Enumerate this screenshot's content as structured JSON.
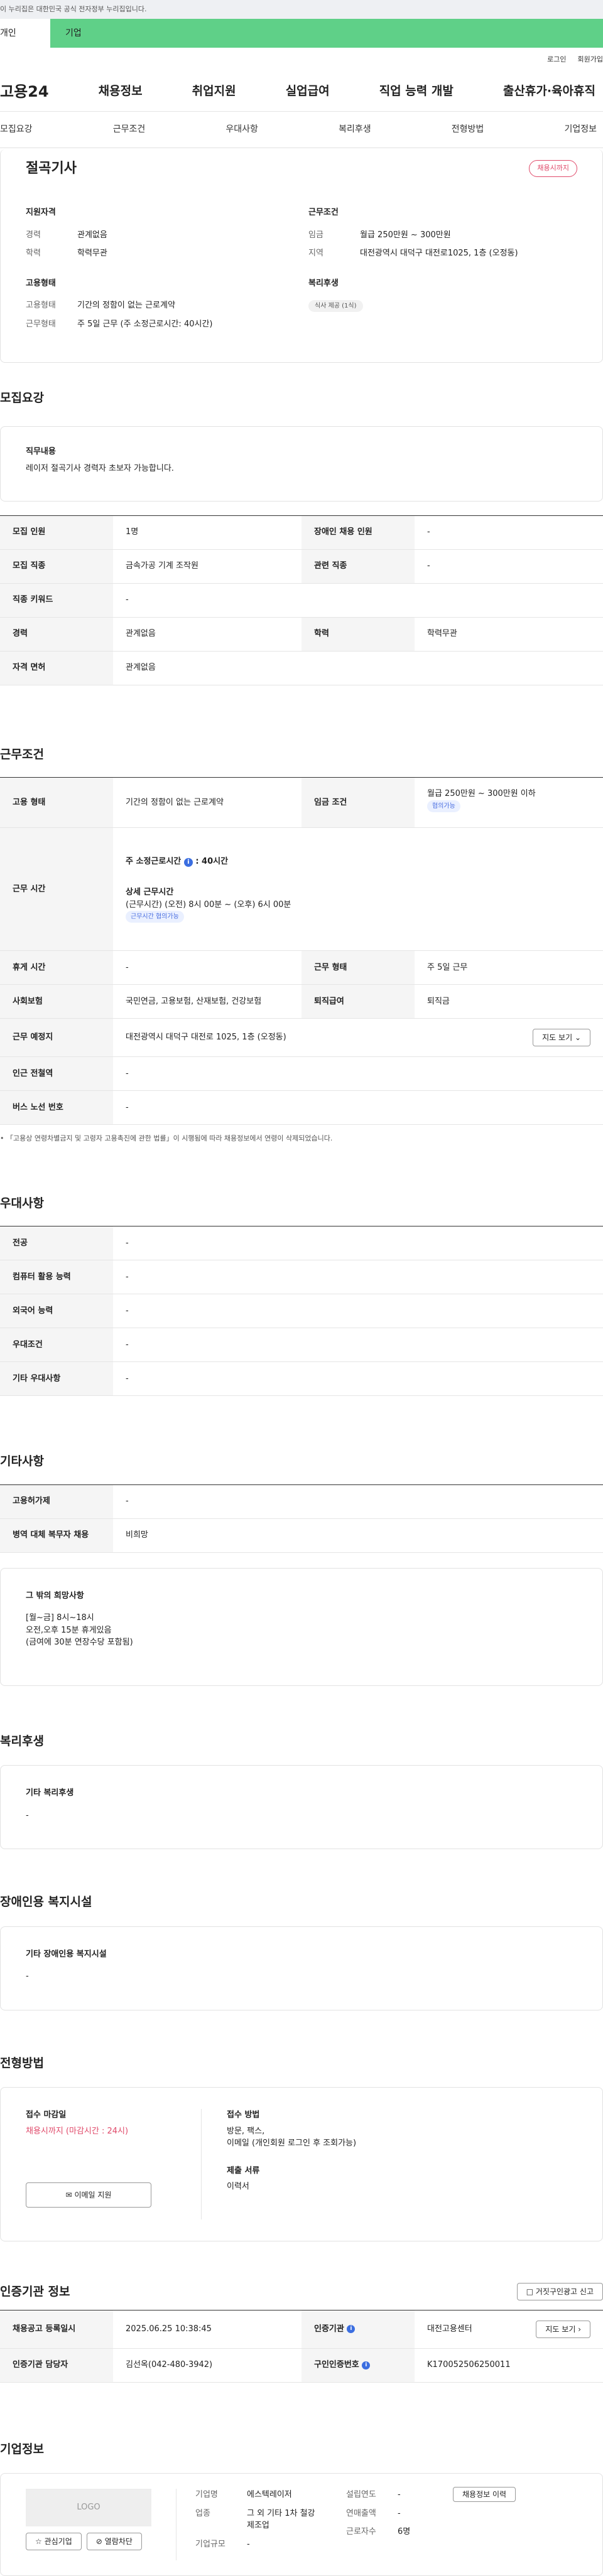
{
  "gov_text": "이 누리집은 대한민국 공식 전자정부 누리집입니다.",
  "toggle": {
    "person": "개인",
    "company": "기업"
  },
  "util": {
    "login": "로그인",
    "join": "회원가입"
  },
  "gnb": {
    "logo": "고용24",
    "menus": [
      "채용정보",
      "취업지원",
      "실업급여",
      "직업 능력 개발",
      "출산휴가·육아휴직"
    ]
  },
  "subnav": [
    "모집요강",
    "근무조건",
    "우대사항",
    "복리후생",
    "전형방법",
    "기업정보"
  ],
  "job": {
    "title": "절곡기사",
    "status": "채용시까지",
    "left_h": "지원자격",
    "exp_k": "경력",
    "exp_v": "관계없음",
    "edu_k": "학력",
    "edu_v": "학력무관",
    "emp_h": "고용형태",
    "type_k": "고용형태",
    "type_v": "기간의 정함이 없는 근로계약",
    "work_k": "근무형태",
    "work_v": "주 5일 근무 (주 소정근로시간: 40시간)",
    "right_h": "근무조건",
    "wage_k": "임금",
    "wage_v": "월급 250만원 ~ 300만원",
    "loc_k": "지역",
    "loc_v": "대전광역시 대덕구 대전로1025, 1층 (오정동)",
    "wel_h": "복리후생",
    "wel_tag": "식사 제공 (1식)"
  },
  "recruit": {
    "h": "모집요강",
    "duty_h": "직무내용",
    "duty_v": "레이저 절곡기사  경력자 초보자 가능합니다.",
    "rows": [
      [
        "모집 인원",
        "1명",
        "장애인 채용 인원",
        "-"
      ],
      [
        "모집 직종",
        "금속가공 기계 조작원",
        "관련 직종",
        "-"
      ],
      [
        "직종 키워드",
        "-",
        "",
        ""
      ],
      [
        "경력",
        "관계없음",
        "학력",
        "학력무관"
      ],
      [
        "자격 면허",
        "관계없음",
        "",
        ""
      ]
    ]
  },
  "cond": {
    "h": "근무조건",
    "type_k": "고용 형태",
    "type_v": "기간의 정함이 없는 근로계약",
    "wage_k": "임금 조건",
    "wage_v": "월급 250만원 ~ 300만원 이하",
    "wage_tag": "협의가능",
    "time_k": "근무 시간",
    "time_a": "주 소정근로시간",
    "time_b": ": 40시간",
    "time_c": "상세 근무시간",
    "time_d": "(근무시간) (오전) 8시 00분 ~ (오후) 6시 00분",
    "time_tag": "근무시간 협의가능",
    "rest_k": "휴게 시간",
    "rest_v": "-",
    "form_k": "근무 형태",
    "form_v": "주 5일 근무",
    "ins_k": "사회보험",
    "ins_v": "국민연금, 고용보험, 산재보험, 건강보험",
    "ret_k": "퇴직급여",
    "ret_v": "퇴직금",
    "loc_k": "근무 예정지",
    "loc_v": "대전광역시 대덕구 대전로 1025, 1층 (오정동)",
    "map_btn": "지도 보기",
    "sub_k": "인근 전철역",
    "sub_v": "-",
    "bus_k": "버스 노선 번호",
    "bus_v": "-",
    "note": "• 「고용상 연령차별금지 및 고령자 고용촉진에 관한 법률」이 시행됨에 따라 채용정보에서 연령이 삭제되었습니다."
  },
  "pref": {
    "h": "우대사항",
    "rows": [
      [
        "전공",
        "-"
      ],
      [
        "컴퓨터 활용 능력",
        "-"
      ],
      [
        "외국어 능력",
        "-"
      ],
      [
        "우대조건",
        "-"
      ],
      [
        "기타 우대사항",
        "-"
      ]
    ]
  },
  "etc": {
    "h": "기타사항",
    "rows": [
      [
        "고용허가제",
        "-"
      ],
      [
        "병역 대체 복무자 채용",
        "비희망"
      ]
    ],
    "wish_h": "그 밖의 희망사항",
    "wish_lines": [
      "[월~금] 8시~18시",
      "오전,오후 15분 휴게있음",
      "(금여에 30분 연장수당 포함됨)"
    ]
  },
  "welfare": {
    "h": "복리후생",
    "sh": "기타 복리후생",
    "v": "-"
  },
  "dis": {
    "h": "장애인용 복지시설",
    "sh": "기타 장애인용 복지시설",
    "v": "-"
  },
  "select": {
    "h": "전형방법",
    "dead_h": "접수 마감일",
    "dead_v": "채용시까지 (마감시간 : 24시)",
    "email_btn": "이메일 지원",
    "method_h": "접수 방법",
    "method_v1": "방문, 팩스,",
    "method_v2": "이메일 (개인회원 로그인 후 조회가능)",
    "docs_h": "제출 서류",
    "docs_v": "이력서"
  },
  "org": {
    "h": "인증기관 정보",
    "report_btn": "거짓구인광고 신고",
    "reg_k": "채용공고 등록일시",
    "reg_v": "2025.06.25 10:38:45",
    "org_k": "인증기관",
    "org_v": "대전고용센터",
    "map_btn": "지도 보기",
    "mgr_k": "인증기관 담당자",
    "mgr_v": "김선옥(042-480-3942)",
    "num_k": "구인인증번호",
    "num_v": "K170052506250011"
  },
  "company": {
    "h": "기업정보",
    "logo": "LOGO",
    "fav": "관심기업",
    "block": "열람차단",
    "name_k": "기업명",
    "name_v": "에스텍레이저",
    "ind_k": "업종",
    "ind_v": "그 외 기타 1차 철강 제조업",
    "scale_k": "기업규모",
    "scale_v": "-",
    "year_k": "설립연도",
    "year_v": "-",
    "sales_k": "연매출액",
    "sales_v": "-",
    "staff_k": "근로자수",
    "staff_v": "6명",
    "hist_btn": "채용정보 이력"
  }
}
